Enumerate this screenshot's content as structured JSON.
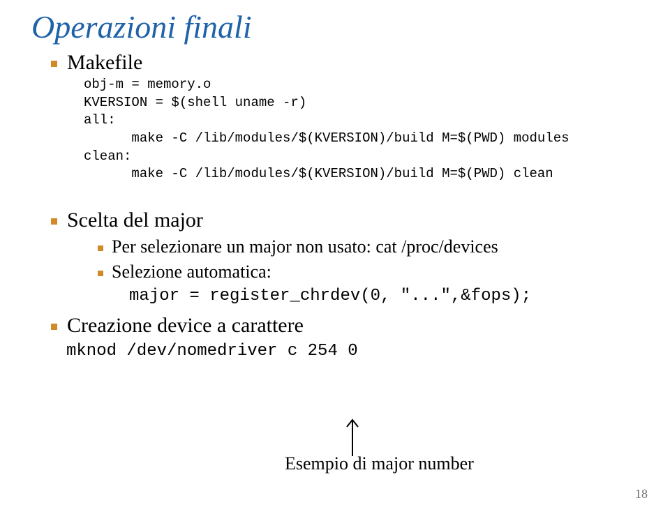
{
  "title": "Operazioni finali",
  "makefile": {
    "label": "Makefile",
    "code": "obj-m = memory.o\nKVERSION = $(shell uname -r)\nall:\n      make -C /lib/modules/$(KVERSION)/build M=$(PWD) modules\nclean:\n      make -C /lib/modules/$(KVERSION)/build M=$(PWD) clean"
  },
  "major": {
    "label": "Scelta del major",
    "sub1": "Per selezionare un major non usato: cat /proc/devices",
    "sub2": "Selezione automatica:",
    "code": "major = register_chrdev(0, \"...\",&fops);"
  },
  "device": {
    "label": "Creazione device a carattere",
    "code": "mknod /dev/nomedriver c 254 0"
  },
  "example_label": "Esempio  di major number",
  "page_number": "18"
}
